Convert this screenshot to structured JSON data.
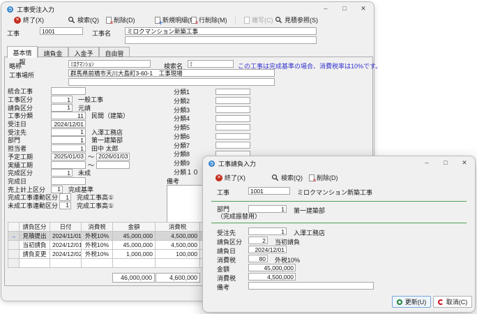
{
  "main": {
    "title": "工事受注入力",
    "toolbar": {
      "exit": "終了(X)",
      "search": "検索(Q)",
      "delete": "削除(D)",
      "new_detail": "新規明細(N)",
      "row_delete": "行削除(M)",
      "copy": "複写(C)",
      "estimate_ref": "見積参照(S)"
    },
    "header": {
      "project_label": "工事",
      "project_code": "1001",
      "name_label": "工事名",
      "project_name": "ミロクマンション新築工事",
      "project_name2": ""
    },
    "tabs": {
      "basic": "基本情報",
      "contract": "請負金額",
      "deposit": "入金予定",
      "free": "自由管理"
    },
    "basic": {
      "abbr_label": "略称",
      "abbr": "ﾐﾛｸﾏﾝｼｮﾝ",
      "search_label": "検索名",
      "search_value": "ﾐ",
      "notice": "この工事は完成基準の場合、消費税率は10%です。",
      "location_label": "工事場所",
      "location": "群馬県前橋市天川大島町3-60-1　工事現場",
      "location2": "",
      "tilde": "～",
      "fields": [
        {
          "label": "統合工事",
          "code": "",
          "text": ""
        },
        {
          "label": "工事区分",
          "code": "1",
          "text": "一般工事"
        },
        {
          "label": "請負区分",
          "code": "1",
          "text": "元請"
        },
        {
          "label": "工事分類",
          "code": "11",
          "text": "民間（建築）"
        },
        {
          "label": "受注日",
          "code": "2024/12/01",
          "text": ""
        },
        {
          "label": "受注先",
          "code": "1",
          "text": "入澤工務店"
        },
        {
          "label": "部門",
          "code": "1",
          "text": "第一建築部"
        },
        {
          "label": "担当者",
          "code": "1",
          "text": "田中 太郎"
        },
        {
          "label": "予定工期",
          "from": "2025/01/03",
          "to": "2026/01/03"
        },
        {
          "label": "実績工期",
          "from": "",
          "to": ""
        },
        {
          "label": "完成区分",
          "code": "1",
          "text": "未成"
        },
        {
          "label": "完成日",
          "code": "",
          "text": ""
        },
        {
          "label": "売上計上区分",
          "code": "1",
          "text": "完成基準"
        },
        {
          "label": "完成工事連動区分",
          "code": "1",
          "text": "完成工事高①"
        },
        {
          "label": "未成工事連動区分",
          "code": "1",
          "text": "完成工事高①"
        }
      ],
      "categories": [
        {
          "label": "分類1"
        },
        {
          "label": "分類2"
        },
        {
          "label": "分類3"
        },
        {
          "label": "分類4"
        },
        {
          "label": "分類5"
        },
        {
          "label": "分類6"
        },
        {
          "label": "分類7"
        },
        {
          "label": "分類8"
        },
        {
          "label": "分類9"
        },
        {
          "label": "分類１０"
        }
      ],
      "memo_label": "備考",
      "memo": ""
    },
    "table": {
      "arrow": "→",
      "headers": {
        "division": "請負区分",
        "date": "日付",
        "tax_type": "消費税",
        "amount": "金額",
        "tax": "消費税"
      },
      "rows": [
        {
          "division": "見積提出",
          "date": "2024/11/01",
          "tax_type": "外税10%",
          "amount": "45,000,000",
          "tax": "4,500,000"
        },
        {
          "division": "当初請負",
          "date": "2024/12/01",
          "tax_type": "外税10%",
          "amount": "45,000,000",
          "tax": "4,500,000"
        },
        {
          "division": "請負変更",
          "date": "2024/12/02",
          "tax_type": "外税10%",
          "amount": "1,000,000",
          "tax": "100,000"
        }
      ],
      "total_amount": "46,000,000",
      "total_tax": "4,600,000"
    },
    "accent_colors": {
      "notice_blue": "#3232cd",
      "selected_row_gray": "#d6d6d6"
    }
  },
  "overlay": {
    "title": "工事請負入力",
    "toolbar": {
      "exit": "終了(X)",
      "search": "検索(Q)",
      "delete": "削除(D)"
    },
    "fields": {
      "project_label": "工事",
      "project_code": "1001",
      "project_name": "ミロクマンション新築工事",
      "dept_label": "部門",
      "dept_sub": "（完成振替用）",
      "dept_code": "1",
      "dept_name": "第一建築部",
      "customer_label": "受注先",
      "customer_code": "1",
      "customer_name": "入澤工務店",
      "division_label": "請負区分",
      "division_code": "2",
      "division_name": "当初請負",
      "date_label": "請負日",
      "date": "2024/12/01",
      "taxtype_label": "消費税",
      "taxtype_code": "80",
      "taxtype_name": "外税10%",
      "amount_label": "金額",
      "amount": "45,000,000",
      "tax_label": "消費税",
      "tax": "4,500,000",
      "memo_label": "備考",
      "memo": ""
    },
    "buttons": {
      "update": "更新(U)",
      "cancel": "取消(C)"
    },
    "accent_colors": {
      "separator_green": "#4fa053",
      "update_icon_green": "#1e7e34",
      "cancel_icon_red": "#cf1020"
    }
  },
  "window_controls": {
    "minimize": "–",
    "maximize": "□",
    "close": "✕"
  }
}
